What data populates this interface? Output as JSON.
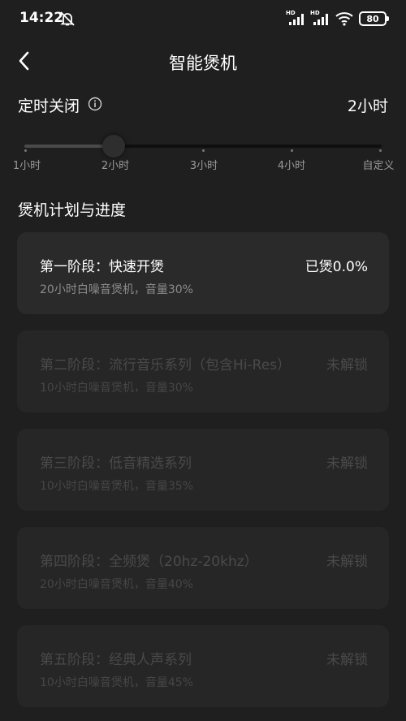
{
  "status_bar": {
    "time": "14:22",
    "mute_icon": "bell-off-icon",
    "signal_badges": [
      "HD",
      "HD"
    ],
    "battery": "80"
  },
  "header": {
    "title": "智能煲机",
    "back_icon": "chevron-left-icon"
  },
  "timer": {
    "label": "定时关闭",
    "info_icon": "info-circle-icon",
    "value": "2小时",
    "slider_value": 0.25,
    "ticks": [
      "1小时",
      "2小时",
      "3小时",
      "4小时",
      "自定义"
    ]
  },
  "plan": {
    "section_title": "煲机计划与进度",
    "stages": [
      {
        "name": "第一阶段：快速开煲",
        "desc": "20小时白噪音煲机，音量30%",
        "status": "已煲0.0%",
        "locked": false
      },
      {
        "name": "第二阶段：流行音乐系列（包含Hi-Res）",
        "desc": "10小时白噪音煲机，音量30%",
        "status": "未解锁",
        "locked": true
      },
      {
        "name": "第三阶段：低音精选系列",
        "desc": "10小时白噪音煲机，音量35%",
        "status": "未解锁",
        "locked": true
      },
      {
        "name": "第四阶段：全频煲（20hz-20khz）",
        "desc": "20小时白噪音煲机，音量40%",
        "status": "未解锁",
        "locked": true
      },
      {
        "name": "第五阶段：经典人声系列",
        "desc": "10小时白噪音煲机，音量45%",
        "status": "未解锁",
        "locked": true
      }
    ]
  },
  "colors": {
    "background": "#1f1f1f",
    "card": "#2a2a2a",
    "card_locked": "#262626",
    "text_primary": "#ffffff",
    "text_secondary": "#8c8c8c",
    "text_locked": "#4a4a4a"
  }
}
